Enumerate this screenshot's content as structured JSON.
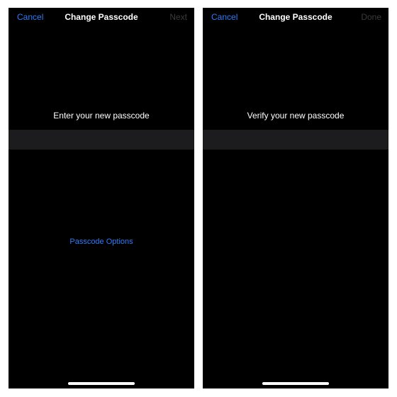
{
  "screens": [
    {
      "nav": {
        "cancel_label": "Cancel",
        "title": "Change Passcode",
        "action_label": "Next"
      },
      "prompt": "Enter your new passcode",
      "options_label": "Passcode Options"
    },
    {
      "nav": {
        "cancel_label": "Cancel",
        "title": "Change Passcode",
        "action_label": "Done"
      },
      "prompt": "Verify your new passcode"
    }
  ],
  "colors": {
    "accent_blue": "#2f7cf6",
    "disabled_gray": "#3b3b3d",
    "background": "#000000",
    "entry_band": "#1c1c1e"
  }
}
